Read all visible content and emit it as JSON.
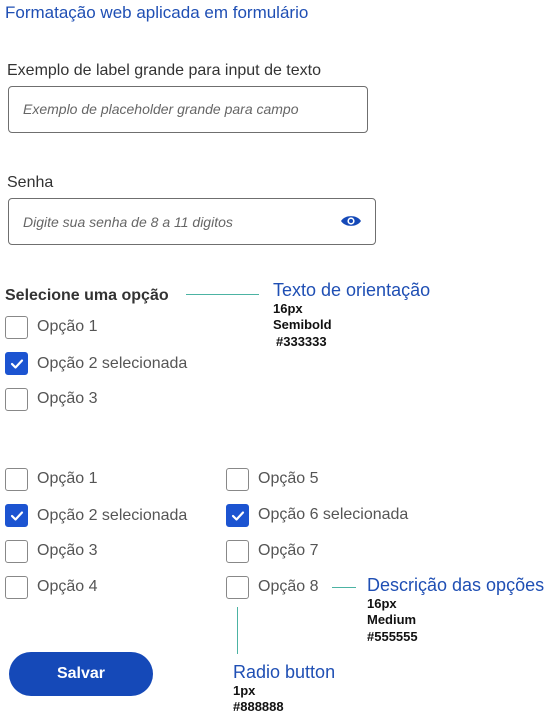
{
  "page": {
    "title": "Formatação web aplicada em formulário"
  },
  "text_field": {
    "label": "Exemplo de label grande para input de texto",
    "placeholder": "Exemplo de placeholder grande para campo"
  },
  "password_field": {
    "label": "Senha",
    "placeholder": "Digite sua senha de 8 a 11 digitos",
    "icon": "eye-icon"
  },
  "single_group": {
    "label": "Selecione uma opção",
    "options": [
      {
        "label": "Opção 1",
        "checked": false
      },
      {
        "label": "Opção 2 selecionada",
        "checked": true
      },
      {
        "label": "Opção 3",
        "checked": false
      }
    ]
  },
  "multi_group": {
    "left": [
      {
        "label": "Opção 1",
        "checked": false
      },
      {
        "label": "Opção 2 selecionada",
        "checked": true
      },
      {
        "label": "Opção 3",
        "checked": false
      },
      {
        "label": "Opção 4",
        "checked": false
      }
    ],
    "right": [
      {
        "label": "Opção 5",
        "checked": false
      },
      {
        "label": "Opção 6 selecionada",
        "checked": true
      },
      {
        "label": "Opção 7",
        "checked": false
      },
      {
        "label": "Opção 8",
        "checked": false
      }
    ]
  },
  "submit": {
    "label": "Salvar"
  },
  "annotations": {
    "guidance": {
      "title": "Texto de orientação",
      "size": "16px",
      "weight": "Semibold",
      "color": "#333333"
    },
    "options_desc": {
      "title": "Descrição das opções",
      "size": "16px",
      "weight": "Medium",
      "color": "#555555"
    },
    "radio": {
      "title": "Radio button",
      "size": "1px",
      "color": "#888888"
    }
  },
  "colors": {
    "accent": "#1c54d1",
    "button": "#1549b8",
    "title": "#1f4fb4",
    "connector": "#4cb3a3"
  }
}
